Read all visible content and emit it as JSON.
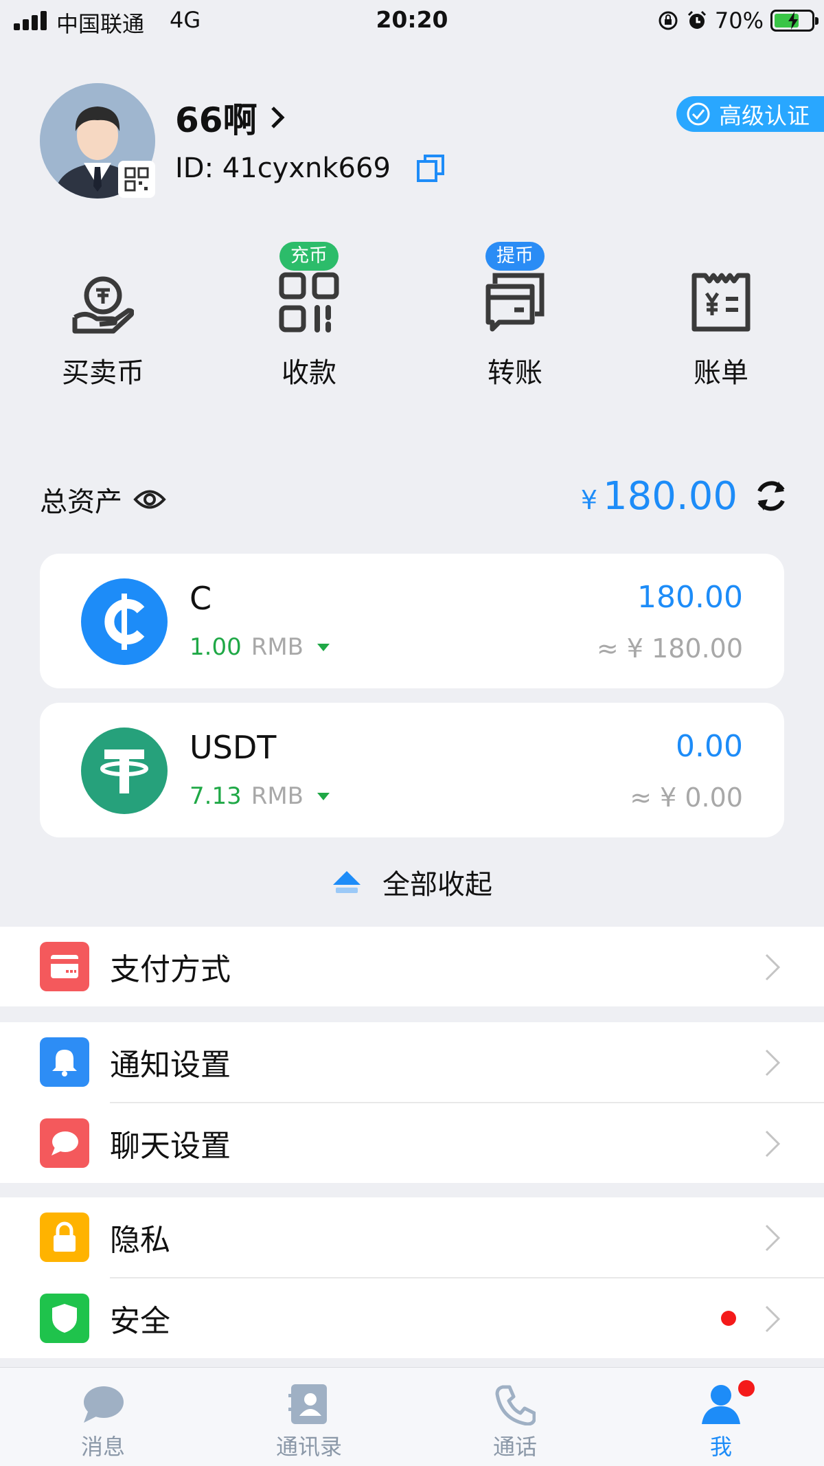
{
  "status_bar": {
    "carrier": "中国联通",
    "network": "4G",
    "time": "20:20",
    "battery_percent": "70%"
  },
  "profile": {
    "username": "66啊",
    "id_text": "ID: 41cyxnk669",
    "verify_badge": "高级认证"
  },
  "actions": [
    {
      "label": "买卖币",
      "icon": "buy-sell-coin-icon",
      "tag": ""
    },
    {
      "label": "收款",
      "icon": "qr-receive-icon",
      "tag": "充币",
      "tag_color": "#2cbc6a"
    },
    {
      "label": "转账",
      "icon": "transfer-icon",
      "tag": "提币",
      "tag_color": "#2a8cf5"
    },
    {
      "label": "账单",
      "icon": "bill-icon",
      "tag": ""
    }
  ],
  "assets": {
    "label": "总资产",
    "currency_symbol": "¥",
    "total": "180.00"
  },
  "coins": [
    {
      "name": "C",
      "rate": "1.00",
      "unit": "RMB",
      "amount": "180.00",
      "equiv": "≈ ¥ 180.00",
      "logo_color": "#1d8cf8",
      "logo_glyph": "₵"
    },
    {
      "name": "USDT",
      "rate": "7.13",
      "unit": "RMB",
      "amount": "0.00",
      "equiv": "≈ ¥ 0.00",
      "logo_color": "#26a17b",
      "logo_glyph": "T"
    }
  ],
  "collapse_label": "全部收起",
  "settings": {
    "payment": {
      "label": "支付方式",
      "icon": "payment-card-icon",
      "color": "#f4595c"
    },
    "notify": {
      "label": "通知设置",
      "icon": "bell-icon",
      "color": "#2d8df5"
    },
    "chat": {
      "label": "聊天设置",
      "icon": "chat-bubble-icon",
      "color": "#f4595c"
    },
    "privacy": {
      "label": "隐私",
      "icon": "lock-icon",
      "color": "#ffb300"
    },
    "security": {
      "label": "安全",
      "icon": "shield-icon",
      "color": "#1fc34c"
    }
  },
  "tabs": [
    {
      "label": "消息",
      "icon": "message-icon",
      "active": false
    },
    {
      "label": "通讯录",
      "icon": "contacts-icon",
      "active": false
    },
    {
      "label": "通话",
      "icon": "phone-icon",
      "active": false
    },
    {
      "label": "我",
      "icon": "me-icon",
      "active": true
    }
  ],
  "colors": {
    "accent": "#1d8cf8",
    "background": "#eeeff3",
    "positive": "#1fa846",
    "alert": "#f41a1a"
  }
}
